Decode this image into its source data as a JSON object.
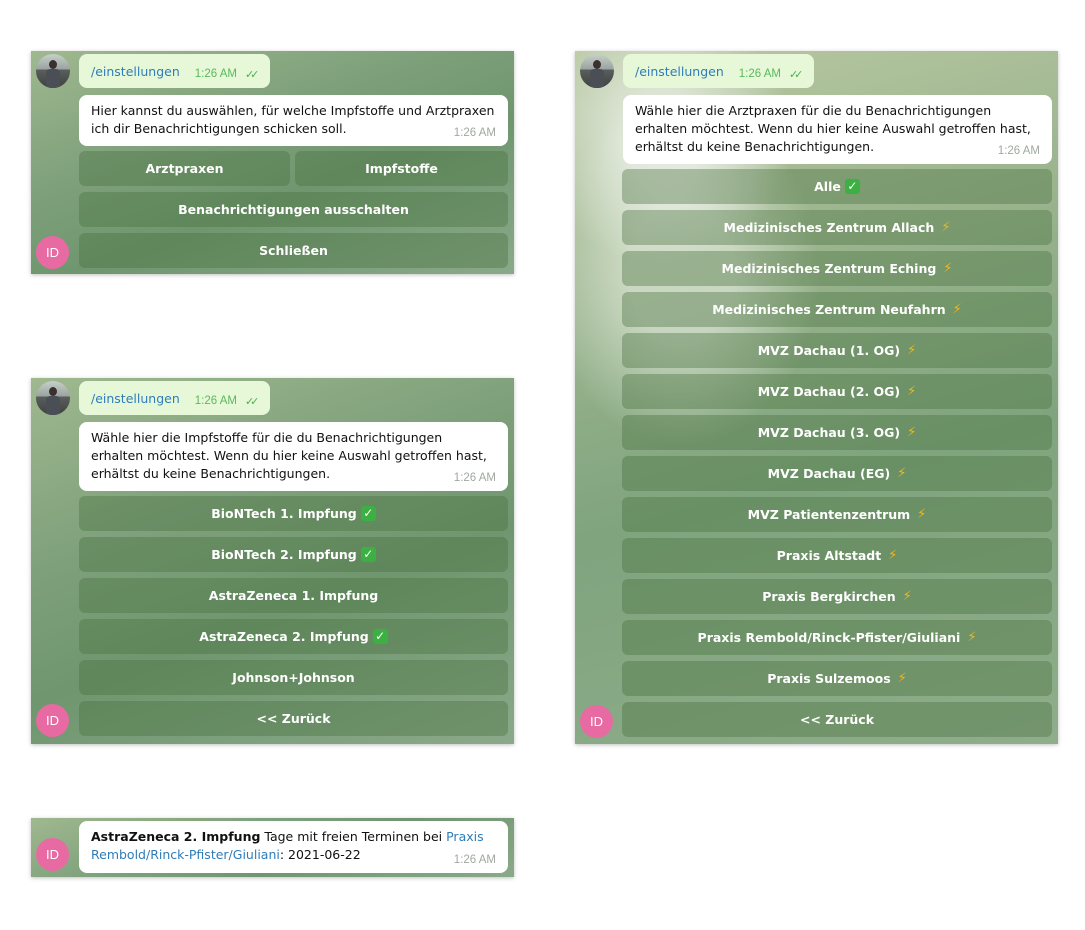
{
  "panel_main": {
    "command": "/einstellungen",
    "command_time": "1:26 AM",
    "message": "Hier kannst du auswählen, für welche Impfstoffe und Arztpraxen ich dir Benachrichtigungen schicken soll.",
    "message_time": "1:26 AM",
    "buttons": [
      "Arztpraxen",
      "Impfstoffe",
      "Benachrichtigungen ausschalten",
      "Schließen"
    ],
    "avatar_initials": "ID"
  },
  "panel_vaccines": {
    "command": "/einstellungen",
    "command_time": "1:26 AM",
    "message": "Wähle hier die Impfstoffe für die du Benachrichtigungen erhalten möchtest. Wenn du hier keine Auswahl getroffen hast, erhältst du keine Benachrichtigungen.",
    "message_time": "1:26 AM",
    "buttons": [
      {
        "label": "BioNTech 1. Impfung",
        "checked": true
      },
      {
        "label": "BioNTech 2. Impfung",
        "checked": true
      },
      {
        "label": "AstraZeneca 1. Impfung",
        "checked": false
      },
      {
        "label": "AstraZeneca 2. Impfung",
        "checked": true
      },
      {
        "label": "Johnson+Johnson",
        "checked": false
      },
      {
        "label": "<< Zurück",
        "checked": false
      }
    ],
    "avatar_initials": "ID"
  },
  "panel_notification": {
    "vaccine": "AstraZeneca 2. Impfung",
    "text_middle": " Tage mit freien Terminen bei ",
    "practice_link": "Praxis Rembold/Rinck-Pfister/Giuliani",
    "date_text": ": 2021-06-22",
    "time": "1:26 AM",
    "avatar_initials": "ID"
  },
  "panel_practices": {
    "command": "/einstellungen",
    "command_time": "1:26 AM",
    "message": "Wähle hier die Arztpraxen für die du Benachrichtigungen erhalten möchtest. Wenn du hier keine Auswahl getroffen hast, erhältst du keine Benachrichtigungen.",
    "message_time": "1:26 AM",
    "buttons": [
      {
        "label": "Alle",
        "icon": "check"
      },
      {
        "label": "Medizinisches Zentrum Allach",
        "icon": "bolt"
      },
      {
        "label": "Medizinisches Zentrum Eching",
        "icon": "bolt"
      },
      {
        "label": "Medizinisches Zentrum Neufahrn",
        "icon": "bolt"
      },
      {
        "label": "MVZ Dachau (1. OG)",
        "icon": "bolt"
      },
      {
        "label": "MVZ Dachau (2. OG)",
        "icon": "bolt"
      },
      {
        "label": "MVZ Dachau (3. OG)",
        "icon": "bolt"
      },
      {
        "label": "MVZ Dachau (EG)",
        "icon": "bolt"
      },
      {
        "label": "MVZ Patientenzentrum",
        "icon": "bolt"
      },
      {
        "label": "Praxis Altstadt",
        "icon": "bolt"
      },
      {
        "label": "Praxis Bergkirchen",
        "icon": "bolt"
      },
      {
        "label": "Praxis Rembold/Rinck-Pfister/Giuliani",
        "icon": "bolt"
      },
      {
        "label": "Praxis Sulzemoos",
        "icon": "bolt"
      },
      {
        "label": "<< Zurück",
        "icon": ""
      }
    ],
    "avatar_initials": "ID"
  },
  "colors": {
    "command_bubble": "#e6f8d8",
    "link": "#2f7db8",
    "avatar_id": "#e86aa3",
    "checkmark": "#3cb043",
    "bolt": "#f0b820"
  }
}
